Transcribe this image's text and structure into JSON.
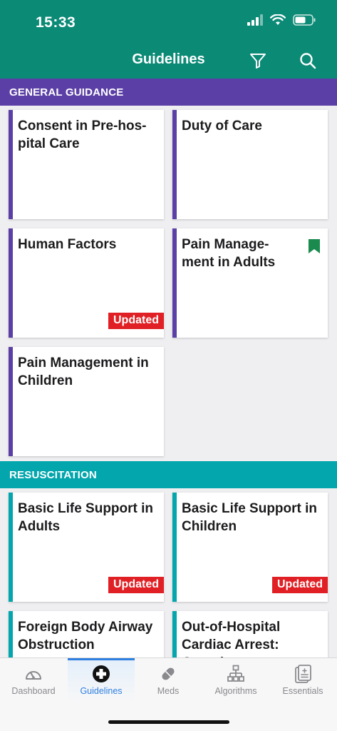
{
  "status": {
    "time": "15:33"
  },
  "nav": {
    "title": "Guidelines",
    "filter_icon": "filter-icon",
    "search_icon": "search-icon"
  },
  "sections": [
    {
      "title": "GENERAL GUIDANCE",
      "color": "#5b3fa6",
      "cards": [
        {
          "title": "Consent in Pre-hos-pital Care",
          "badge": "",
          "bookmarked": false
        },
        {
          "title": "Duty of Care",
          "badge": "",
          "bookmarked": false
        },
        {
          "title": "Human Factors",
          "badge": "Updated",
          "bookmarked": false
        },
        {
          "title": "Pain Manage-ment in Adults",
          "badge": "",
          "bookmarked": true
        },
        {
          "title": "Pain Management in Children",
          "badge": "",
          "bookmarked": false
        }
      ]
    },
    {
      "title": "RESUSCITATION",
      "color": "#04a6ad",
      "cards": [
        {
          "title": "Basic Life Support in Adults",
          "badge": "Updated",
          "bookmarked": false
        },
        {
          "title": "Basic Life Support in Children",
          "badge": "Updated",
          "bookmarked": false
        },
        {
          "title": "Foreign Body Airway Obstruction",
          "badge": "",
          "bookmarked": false
        },
        {
          "title": "Out-of-Hospital Cardiac Arrest: Overview",
          "badge": "",
          "bookmarked": false
        }
      ]
    }
  ],
  "tabs": [
    {
      "label": "Dashboard",
      "icon": "gauge-icon",
      "active": false
    },
    {
      "label": "Guidelines",
      "icon": "medical-cross-icon",
      "active": true
    },
    {
      "label": "Meds",
      "icon": "pill-icon",
      "active": false
    },
    {
      "label": "Algorithms",
      "icon": "flowchart-icon",
      "active": false
    },
    {
      "label": "Essentials",
      "icon": "clipboard-icon",
      "active": false
    }
  ],
  "colors": {
    "header": "#0b8a76",
    "badge": "#e02024",
    "active_tab": "#2f7fe0",
    "bookmark": "#1a8a4e"
  }
}
